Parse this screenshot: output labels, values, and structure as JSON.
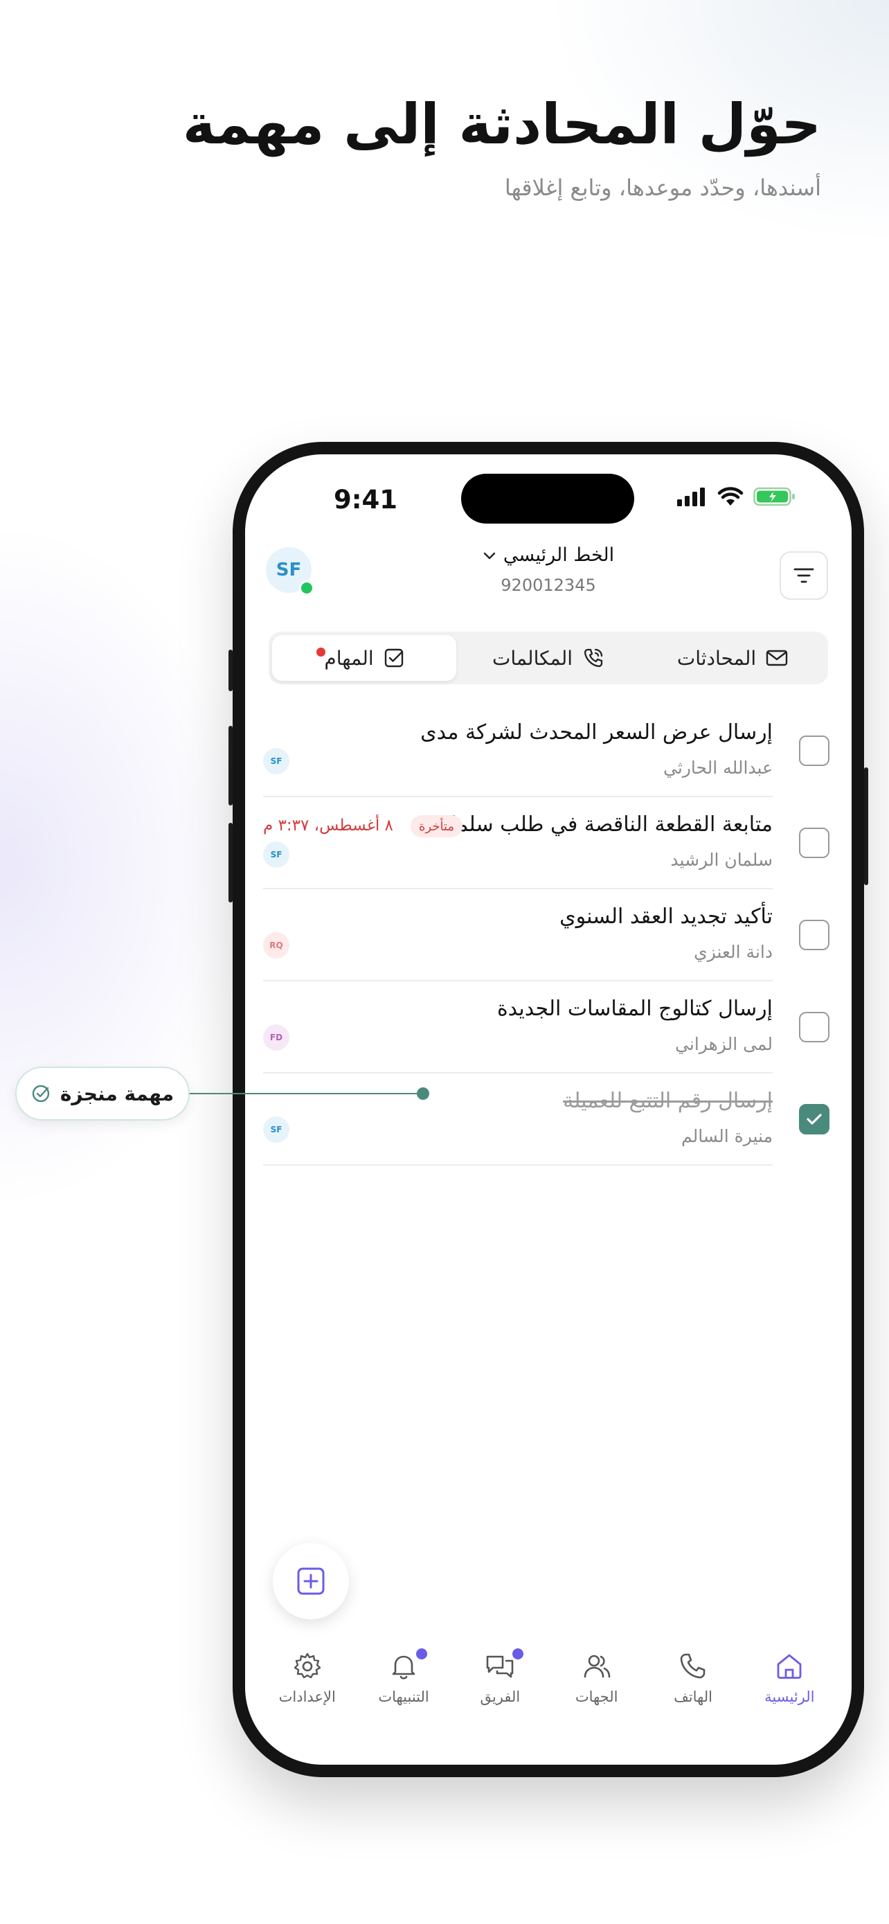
{
  "hero": {
    "title": "حوّل المحادثة إلى مهمة",
    "subtitle": "أسندها، وحدّد موعدها، وتابع إغلاقها"
  },
  "status_bar": {
    "time": "9:41"
  },
  "header": {
    "avatar_initials": "SF",
    "line_name": "الخط الرئيسي",
    "line_number": "920012345"
  },
  "tabs": [
    {
      "label": "المحادثات",
      "icon": "mail-icon",
      "active": false
    },
    {
      "label": "المكالمات",
      "icon": "phone-call-icon",
      "active": false
    },
    {
      "label": "المهام",
      "icon": "checkbox-icon",
      "active": true,
      "has_dot": true
    }
  ],
  "tasks": [
    {
      "title": "إرسال عرض السعر المحدث لشركة مدى",
      "assignee": "عبدالله الحارثي",
      "initials": "SF",
      "done": false
    },
    {
      "title": "متابعة القطعة الناقصة في طلب سلمان",
      "assignee": "سلمان الرشيد",
      "initials": "SF",
      "done": false,
      "badge": "متأخرة",
      "due": "٨ أغسطس، ٣:٣٧ م"
    },
    {
      "title": "تأكيد تجديد العقد السنوي",
      "assignee": "دانة العنزي",
      "initials": "RQ",
      "done": false
    },
    {
      "title": "إرسال كتالوج المقاسات الجديدة",
      "assignee": "لمى الزهراني",
      "initials": "FD",
      "done": false
    },
    {
      "title": "إرسال رقم التتبع للعميلة",
      "assignee": "منيرة السالم",
      "initials": "SF",
      "done": true
    }
  ],
  "bottom_nav": [
    {
      "label": "الرئيسية",
      "icon": "home-icon",
      "active": true
    },
    {
      "label": "الهاتف",
      "icon": "phone-icon"
    },
    {
      "label": "الجهات",
      "icon": "contacts-icon"
    },
    {
      "label": "الفريق",
      "icon": "team-chat-icon",
      "has_dot": true
    },
    {
      "label": "التنبيهات",
      "icon": "bell-icon",
      "has_dot": true
    },
    {
      "label": "الإعدادات",
      "icon": "gear-icon"
    }
  ],
  "callout": {
    "label": "مهمة منجزة"
  },
  "colors": {
    "accent": "#6b5ce7",
    "done_green": "#4a8a7d",
    "late_red": "#d23b3b",
    "online": "#22c55e"
  }
}
